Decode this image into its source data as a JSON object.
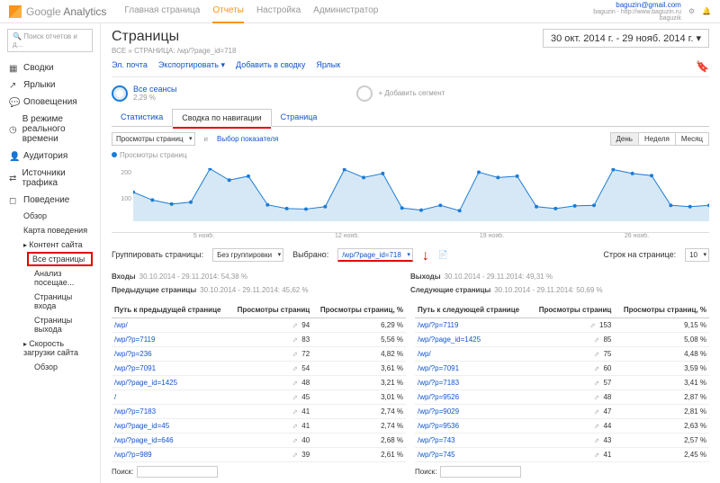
{
  "header": {
    "brand": "Google",
    "brandSub": "Analytics",
    "nav": [
      "Главная страница",
      "Отчеты",
      "Настройка",
      "Администратор"
    ],
    "account_email": "baguzin@gmail.com",
    "account_site": "baguzin - http://www.baguzin.ru",
    "account_view": "baguzik"
  },
  "sidebar": {
    "search_placeholder": "Поиск отчетов и д...",
    "items": [
      {
        "label": "Сводки",
        "icon": "grid"
      },
      {
        "label": "Ярлыки",
        "icon": "arrow"
      },
      {
        "label": "Оповещения",
        "icon": "bubble"
      },
      {
        "label": "В режиме реального времени",
        "icon": "clock"
      },
      {
        "label": "Аудитория",
        "icon": "person"
      },
      {
        "label": "Источники трафика",
        "icon": "arrows"
      },
      {
        "label": "Поведение",
        "icon": "square",
        "expanded": true,
        "sub": [
          {
            "label": "Обзор"
          },
          {
            "label": "Карта поведения"
          },
          {
            "label": "Контент сайта",
            "bullet": true,
            "sub": [
              {
                "label": "Все страницы",
                "highlight": true
              },
              {
                "label": "Анализ посещае..."
              },
              {
                "label": "Страницы входа"
              },
              {
                "label": "Страницы выхода"
              }
            ]
          },
          {
            "label": "Скорость загрузки сайта",
            "bullet": true,
            "sub": [
              {
                "label": "Обзор"
              }
            ]
          }
        ]
      }
    ]
  },
  "content": {
    "title": "Страницы",
    "breadcrumb": "ВСЕ » СТРАНИЦА: /wp/?page_id=718",
    "date_range": "30 окт. 2014 г. - 29 нояб. 2014 г.",
    "subtabs": [
      "Эл. почта",
      "Экспортировать",
      "Добавить в сводку",
      "Ярлык"
    ],
    "seg_all": "Все сеансы",
    "seg_all_pct": "2,29 %",
    "seg_add": "+ Добавить сегмент",
    "tabs2": [
      "Статистика",
      "Сводка по навигации",
      "Страница"
    ],
    "metric_sel": "Просмотры страниц",
    "metric_vs": "Выбор показателя",
    "legend": "Просмотры страниц",
    "time_btns": [
      "День",
      "Неделя",
      "Месяц"
    ],
    "group_label": "Группировать страницы:",
    "group_sel": "Без группировки",
    "selected_label": "Выбрано:",
    "selected_val": "/wp/?page_id=718",
    "rows_label": "Строк на странице:",
    "rows_sel": "10",
    "stats_left": [
      {
        "k": "Входы",
        "v": "30.10.2014 - 29.11.2014: 54,38 %"
      },
      {
        "k": "Предыдущие страницы",
        "v": "30.10.2014 - 29.11.2014: 45,62 %"
      }
    ],
    "stats_right": [
      {
        "k": "Выходы",
        "v": "30.10.2014 - 29.11.2014: 49,31 %"
      },
      {
        "k": "Следующие страницы",
        "v": "30.10.2014 - 29.11.2014: 50,69 %"
      }
    ],
    "table_left": {
      "head": [
        "Путь к предыдущей странице",
        "Просмотры страниц",
        "Просмотры страниц, %"
      ],
      "rows": [
        [
          "/wp/",
          "94",
          "6,29 %"
        ],
        [
          "/wp/?p=7119",
          "83",
          "5,56 %"
        ],
        [
          "/wp/?p=236",
          "72",
          "4,82 %"
        ],
        [
          "/wp/?p=7091",
          "54",
          "3,61 %"
        ],
        [
          "/wp/?page_id=1425",
          "48",
          "3,21 %"
        ],
        [
          "/",
          "45",
          "3,01 %"
        ],
        [
          "/wp/?p=7183",
          "41",
          "2,74 %"
        ],
        [
          "/wp/?page_id=45",
          "41",
          "2,74 %"
        ],
        [
          "/wp/?page_id=646",
          "40",
          "2,68 %"
        ],
        [
          "/wp/?p=989",
          "39",
          "2,61 %"
        ]
      ]
    },
    "table_right": {
      "head": [
        "Путь к следующей странице",
        "Просмотры страниц",
        "Просмотры страниц, %"
      ],
      "rows": [
        [
          "/wp/?p=7119",
          "153",
          "9,15 %"
        ],
        [
          "/wp/?page_id=1425",
          "85",
          "5,08 %"
        ],
        [
          "/wp/",
          "75",
          "4,48 %"
        ],
        [
          "/wp/?p=7091",
          "60",
          "3,59 %"
        ],
        [
          "/wp/?p=7183",
          "57",
          "3,41 %"
        ],
        [
          "/wp/?p=9526",
          "48",
          "2,87 %"
        ],
        [
          "/wp/?p=9029",
          "47",
          "2,81 %"
        ],
        [
          "/wp/?p=9536",
          "44",
          "2,63 %"
        ],
        [
          "/wp/?p=743",
          "43",
          "2,57 %"
        ],
        [
          "/wp/?p=745",
          "41",
          "2,45 %"
        ]
      ]
    },
    "search_label": "Поиск:"
  },
  "chart_data": {
    "type": "line",
    "xlabel": "",
    "ylabel": "",
    "ylim": [
      0,
      200
    ],
    "yticks": [
      100,
      200
    ],
    "categories": [
      "5 нояб.",
      "12 нояб.",
      "19 нояб.",
      "26 нояб."
    ],
    "series": [
      {
        "name": "Просмотры страниц",
        "values": [
          110,
          80,
          65,
          72,
          198,
          155,
          170,
          62,
          48,
          46,
          55,
          195,
          165,
          180,
          50,
          42,
          60,
          40,
          185,
          165,
          170,
          55,
          48,
          58,
          60,
          195,
          180,
          172,
          60,
          55,
          60
        ]
      }
    ]
  }
}
